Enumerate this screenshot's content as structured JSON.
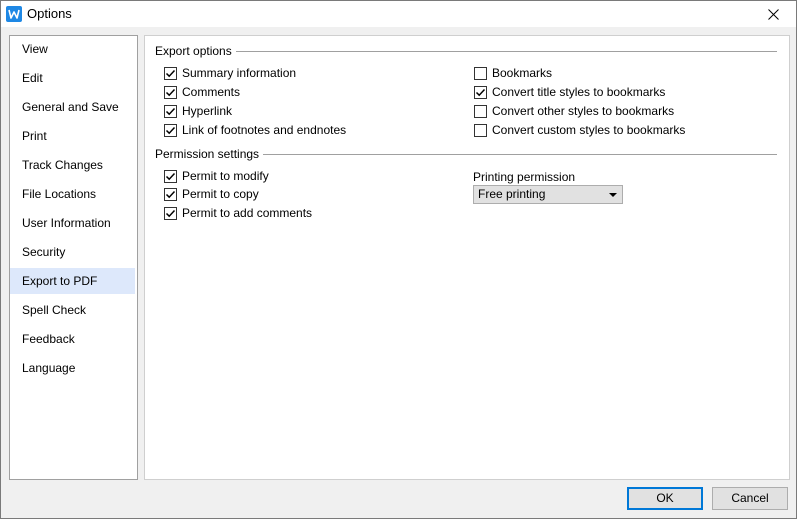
{
  "window": {
    "title": "Options"
  },
  "sidebar": {
    "items": [
      {
        "label": "View"
      },
      {
        "label": "Edit"
      },
      {
        "label": "General and Save"
      },
      {
        "label": "Print"
      },
      {
        "label": "Track Changes"
      },
      {
        "label": "File Locations"
      },
      {
        "label": "User Information"
      },
      {
        "label": "Security"
      },
      {
        "label": "Export to PDF",
        "selected": true
      },
      {
        "label": "Spell Check"
      },
      {
        "label": "Feedback"
      },
      {
        "label": "Language"
      }
    ]
  },
  "export_options": {
    "title": "Export options",
    "left": [
      {
        "label": "Summary information",
        "checked": true
      },
      {
        "label": "Comments",
        "checked": true
      },
      {
        "label": "Hyperlink",
        "checked": true
      },
      {
        "label": "Link of footnotes and endnotes",
        "checked": true
      }
    ],
    "right": [
      {
        "label": "Bookmarks",
        "checked": false
      },
      {
        "label": "Convert title styles to bookmarks",
        "checked": true
      },
      {
        "label": "Convert other styles to bookmarks",
        "checked": false
      },
      {
        "label": "Convert custom styles to bookmarks",
        "checked": false
      }
    ]
  },
  "permission_settings": {
    "title": "Permission settings",
    "items": [
      {
        "label": "Permit to modify",
        "checked": true
      },
      {
        "label": "Permit to copy",
        "checked": true
      },
      {
        "label": "Permit to add comments",
        "checked": true
      }
    ],
    "printing_permission": {
      "label": "Printing permission",
      "value": "Free printing"
    }
  },
  "buttons": {
    "ok": "OK",
    "cancel": "Cancel"
  },
  "colors": {
    "selected_item": "#dde8fb",
    "accent": "#0078d7",
    "app_icon": "#1e88e5"
  }
}
